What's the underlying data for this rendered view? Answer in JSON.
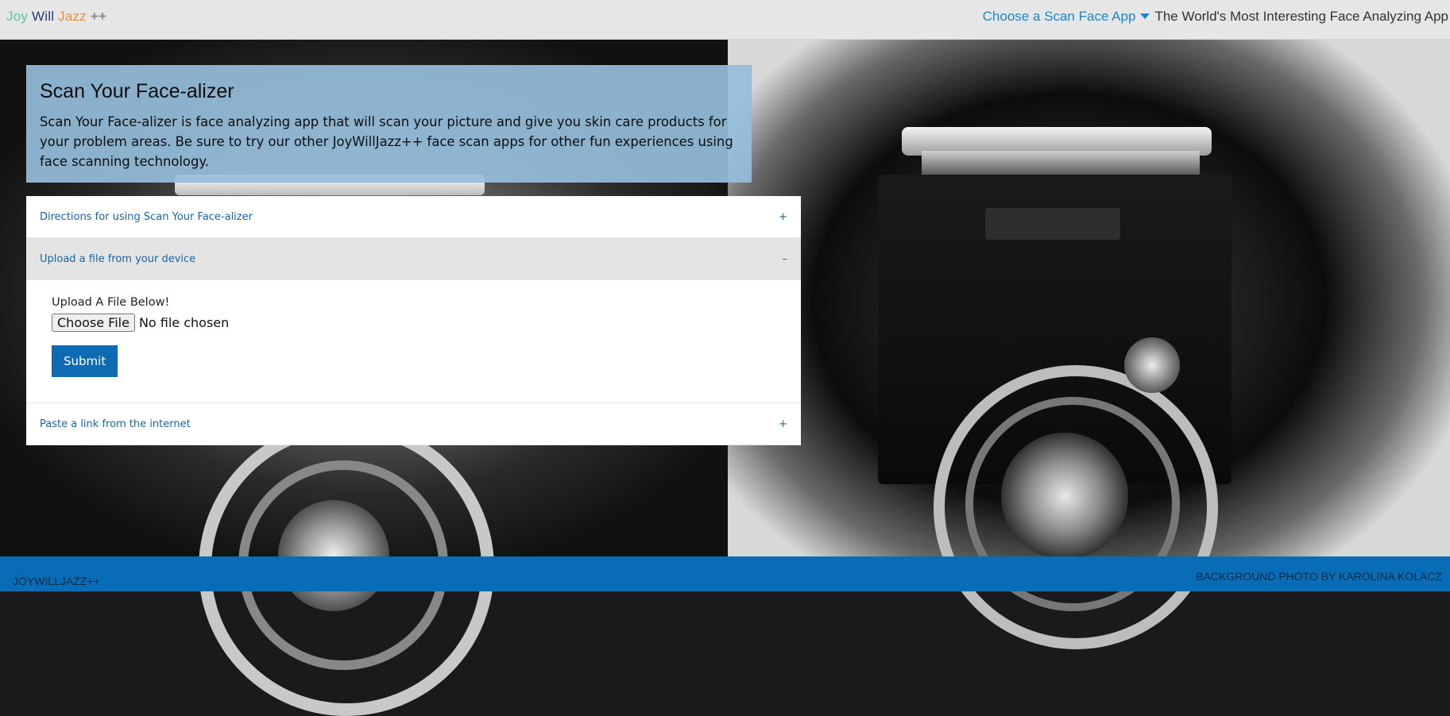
{
  "nav": {
    "brand": {
      "part1": "Joy",
      "part2": "Will",
      "part3": "Jazz",
      "part4": "++"
    },
    "dropdown_label": "Choose a Scan Face App",
    "tagline": "The World's Most Interesting Face Analyzing App"
  },
  "hero": {
    "title": "Scan Your Face-alizer",
    "description": "Scan Your Face-alizer is face analyzing app that will scan your picture and give you skin care products for your problem areas. Be sure to try our other JoyWillJazz++ face scan apps for other fun experiences using face scanning technology."
  },
  "accordion": {
    "items": [
      {
        "title": "Directions for using Scan Your Face-alizer",
        "sign": "+"
      },
      {
        "title": "Upload a file from your device",
        "sign": "–"
      },
      {
        "title": "Paste a link from the internet",
        "sign": "+"
      }
    ],
    "upload": {
      "label": "Upload A File Below!",
      "file_button": "Choose File",
      "file_status": "No file chosen",
      "submit": "Submit"
    }
  },
  "footer": {
    "left": "JOYWILLJAZZ++",
    "right": "BACKGROUND PHOTO BY KAROLINA KOLACZ"
  },
  "colors": {
    "accent": "#1a86c8",
    "footer": "#086cb6",
    "callout": "#96bedc",
    "submit": "#0e6bb2"
  }
}
